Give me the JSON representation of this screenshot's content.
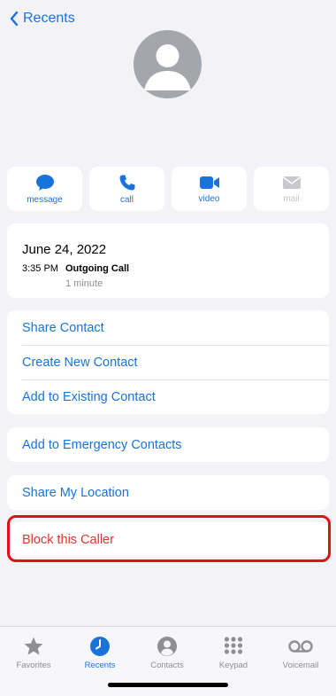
{
  "nav": {
    "back_label": "Recents"
  },
  "colors": {
    "accent": "#1a73d9",
    "danger": "#e0352b",
    "highlight": "#e0101a"
  },
  "actions": [
    {
      "label": "message",
      "icon": "message-bubble-icon",
      "enabled": true
    },
    {
      "label": "call",
      "icon": "phone-icon",
      "enabled": true
    },
    {
      "label": "video",
      "icon": "video-camera-icon",
      "enabled": true
    },
    {
      "label": "mail",
      "icon": "envelope-icon",
      "enabled": false
    }
  ],
  "call_info": {
    "date": "June 24, 2022",
    "time": "3:35 PM",
    "type": "Outgoing Call",
    "duration": "1 minute"
  },
  "contact_options": [
    "Share Contact",
    "Create New Contact",
    "Add to Existing Contact"
  ],
  "emergency": "Add to Emergency Contacts",
  "location": "Share My Location",
  "block": "Block this Caller",
  "tabs": [
    {
      "label": "Favorites",
      "icon": "star-icon",
      "active": false
    },
    {
      "label": "Recents",
      "icon": "clock-icon",
      "active": true
    },
    {
      "label": "Contacts",
      "icon": "person-circle-icon",
      "active": false
    },
    {
      "label": "Keypad",
      "icon": "keypad-icon",
      "active": false
    },
    {
      "label": "Voicemail",
      "icon": "voicemail-icon",
      "active": false
    }
  ]
}
